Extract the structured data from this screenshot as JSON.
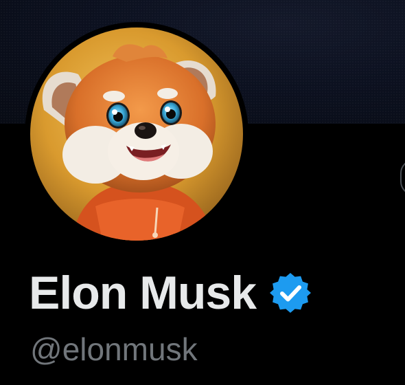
{
  "profile": {
    "display_name": "Elon Musk",
    "handle": "@elonmusk",
    "verified": true,
    "avatar_subject": "red-panda-cartoon"
  },
  "colors": {
    "background": "#000000",
    "banner": "#0c1120",
    "name_text": "#e7e9ea",
    "handle_text": "#71767b",
    "verified_badge": "#1d9bf0"
  },
  "icons": {
    "verified": "verified-badge-icon"
  }
}
